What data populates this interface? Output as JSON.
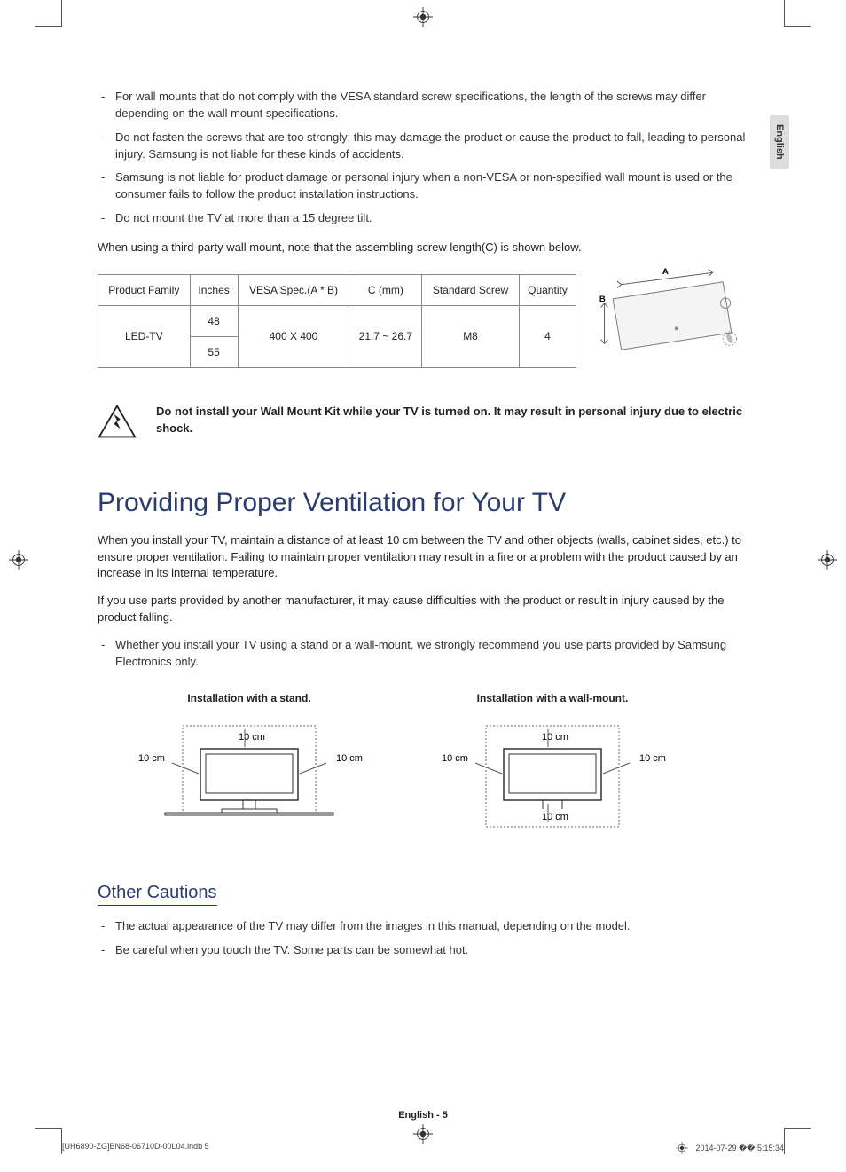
{
  "sideTab": "English",
  "bullets1": [
    "For wall mounts that do not comply with the VESA standard screw specifications, the length of the screws may differ depending on the wall mount specifications.",
    "Do not fasten the screws that are too strongly; this may damage the product or cause the product to fall, leading to personal injury. Samsung is not liable for these kinds of accidents.",
    "Samsung is not liable for product damage or personal injury when a non-VESA or non-specified wall mount is used or the consumer fails to follow the product installation instructions.",
    "Do not mount the TV at more than a 15 degree tilt."
  ],
  "plain1": "When using a third-party wall mount, note that the assembling screw length(C) is shown below.",
  "table": {
    "headers": [
      "Product Family",
      "Inches",
      "VESA Spec.(A * B)",
      "C (mm)",
      "Standard Screw",
      "Quantity"
    ],
    "family": "LED-TV",
    "inches": [
      "48",
      "55"
    ],
    "vesa": "400 X 400",
    "cmm": "21.7 ~ 26.7",
    "screw": "M8",
    "qty": "4"
  },
  "diagramLabels": {
    "A": "A",
    "B": "B"
  },
  "warning": "Do not install your Wall Mount Kit while your TV is turned on. It may result in personal injury due to electric shock.",
  "h1": "Providing Proper Ventilation for Your TV",
  "vent1": "When you install your TV, maintain a distance of at least 10 cm between the TV and other objects (walls, cabinet sides, etc.) to ensure proper ventilation. Failing to maintain proper ventilation may result in a fire or a problem with the product caused by an increase in its internal temperature.",
  "vent2": "If you use parts provided by another manufacturer, it may cause difficulties with the product or result in injury caused by the product falling.",
  "ventBullet": "Whether you install your TV using a stand or a wall-mount, we strongly recommend you use parts provided by Samsung Electronics only.",
  "install": {
    "standCaption": "Installation with a stand.",
    "wallCaption": "Installation with a wall-mount.",
    "dist": "10 cm"
  },
  "h2": "Other Cautions",
  "cautions": [
    "The actual appearance of the TV may differ from the images in this manual, depending on the model.",
    "Be careful when you touch the TV. Some parts can be somewhat hot."
  ],
  "footerPage": "English - 5",
  "indd": {
    "left": "[UH6890-ZG]BN68-06710D-00L04.indb   5",
    "date": "2014-07-29   �� 5:15:34"
  }
}
